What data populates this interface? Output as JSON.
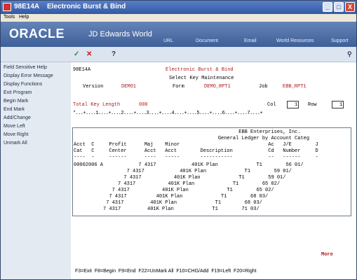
{
  "window": {
    "id": "98E14A",
    "title": "Electronic Burst & Bind",
    "controls": [
      "_",
      "□",
      "X"
    ]
  },
  "menu": [
    "Tools",
    "Help"
  ],
  "banner": {
    "brand": "ORACLE",
    "product": "JD Edwards World",
    "links": [
      "URL",
      "Document",
      "Email",
      "World Resources",
      "Support"
    ]
  },
  "toolbar": {
    "ok_icon": "✓",
    "cancel_icon": "✕",
    "help_icon": "?",
    "search_icon": "⚲"
  },
  "left_menu": [
    "Field Sensitive Help",
    "Display Error Message",
    "Display Functions",
    "Exit Program",
    "Begin Mark",
    "End Mark",
    "Add/Change",
    "Move Left",
    "Move Right",
    "Unmark All"
  ],
  "screen": {
    "program": "98E14A",
    "heading1": "Electronic Burst & Bind",
    "heading2": "Select Key Maintenance",
    "version_label": "Version",
    "version_value": "DEMO1",
    "form_label": "Form",
    "form_value": "DEMO_RPT1",
    "job_label": "Job",
    "job_value": "EBB_RPT1",
    "total_key_label": "Total Key Length",
    "total_key_value": "000",
    "col_label": "Col",
    "col_value": "1",
    "row_label": "Row",
    "row_value": "1",
    "ruler": "*...+....1....+....2....+....3....+....4....+....5....+....6....+....7....+",
    "report_lines": [
      "                                                        EBB Enterprises, Inc.",
      "                                                 General Ledger by Account Categ",
      "Acct  C     Profit      Maj    Minor                              Ac   J/E        J",
      "Cat   C     Center      Acct   Acct        Description            Cd   Number     D",
      "----  -     ------      ----   -----       -----------            --   ------     -",
      "00002006 A            7 4317            401K Plan             T1        56 01/",
      "                  7 4317            401K Plan             T1        59 01/",
      "                 7 4317           401K Plan             T1        59 01/",
      "               7 4317           401K Plan             T1        65 02/",
      "             7 4317           401K Plan             T1        65 02/",
      "            7 4317          401K Plan             T1        68 03/",
      "           7 4317         401K Plan             T1        68 03/",
      "          7 4317         401K Plan             T1        71 03/"
    ],
    "more": "More",
    "function_keys": "F3=Exit  F8=Begin  F9=End  F22=UnMark All  F10=CHG/Add  F19=Left  F20=Right"
  }
}
